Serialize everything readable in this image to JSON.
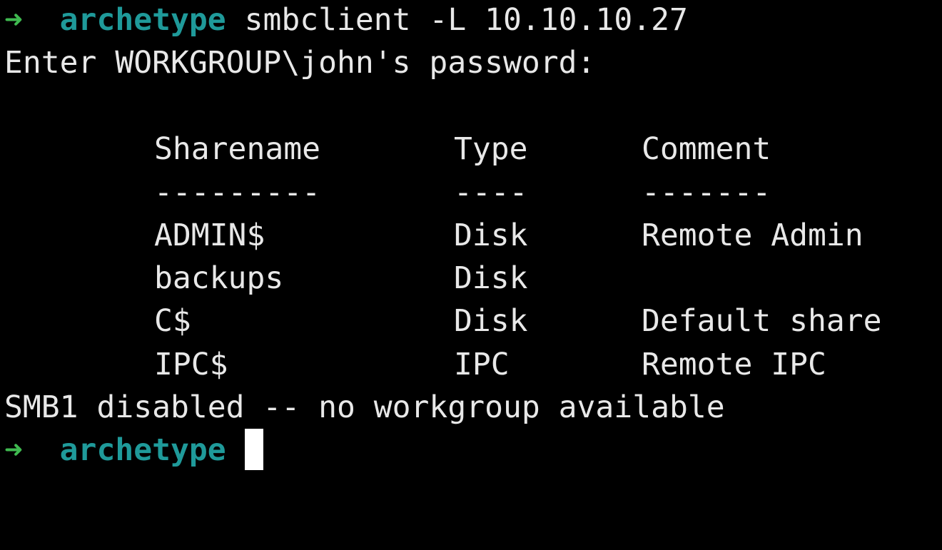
{
  "terminal": {
    "prompt_arrow": "➜",
    "prompt_dir": "archetype",
    "command": "smbclient -L 10.10.10.27",
    "password_prompt": "Enter WORKGROUP\\john's password:",
    "table": {
      "headers": [
        "Sharename",
        "Type",
        "Comment"
      ],
      "separators": [
        "---------",
        "----",
        "-------"
      ],
      "rows": [
        [
          "ADMIN$",
          "Disk",
          "Remote Admin"
        ],
        [
          "backups",
          "Disk",
          ""
        ],
        [
          "C$",
          "Disk",
          "Default share"
        ],
        [
          "IPC$",
          "IPC",
          "Remote IPC"
        ]
      ]
    },
    "status_message": "SMB1 disabled -- no workgroup available",
    "colors": {
      "background": "#000000",
      "foreground": "#e8e8e8",
      "prompt_arrow": "#3fb950",
      "prompt_dir": "#1f9a9a",
      "cursor": "#ffffff"
    }
  }
}
